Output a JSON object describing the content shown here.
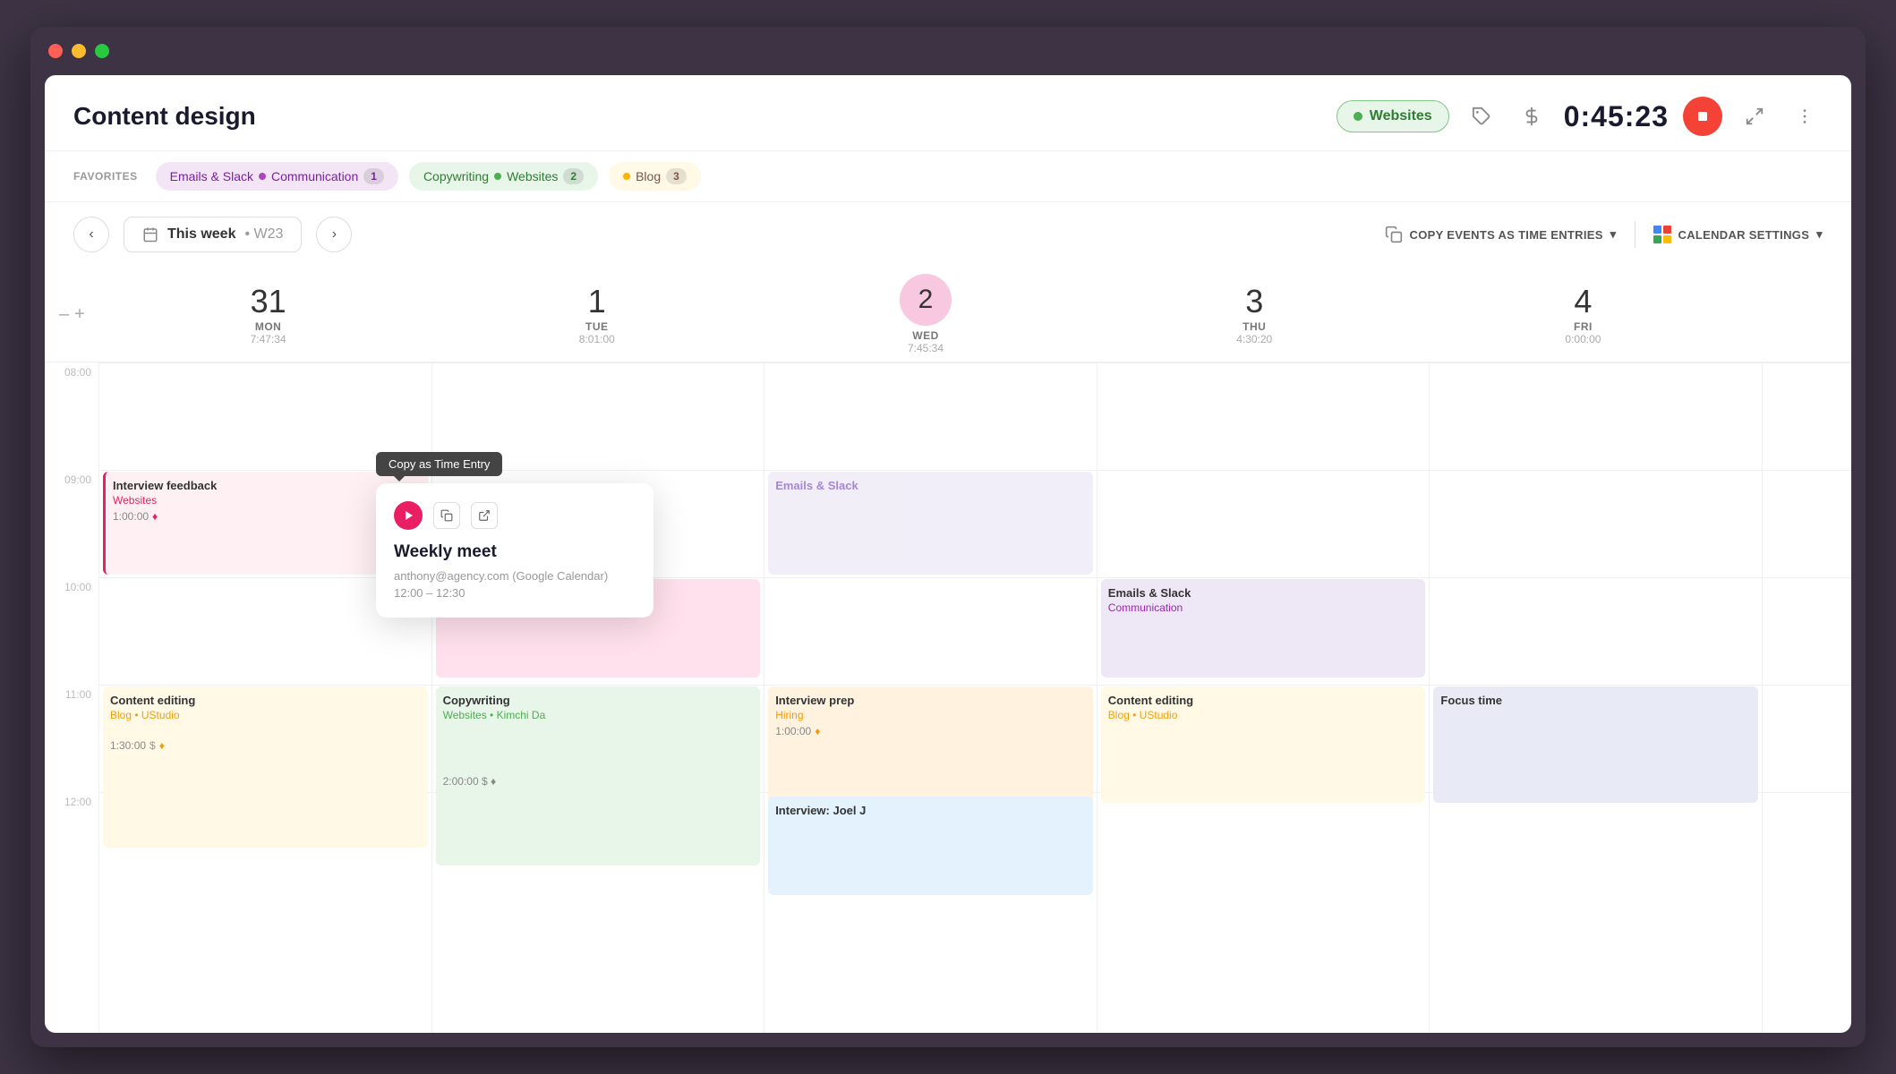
{
  "window": {
    "title": "Content design"
  },
  "header": {
    "title": "Content design",
    "website_badge": "Websites",
    "timer": "0:45:23"
  },
  "favorites": {
    "label": "FAVORITES",
    "items": [
      {
        "name": "emails-slack",
        "text": "Emails & Slack",
        "tag": "Communication",
        "count": "1",
        "color": "purple"
      },
      {
        "name": "copywriting",
        "text": "Copywriting",
        "tag": "Websites",
        "count": "2",
        "color": "green"
      },
      {
        "name": "blog",
        "text": "Blog",
        "count": "3",
        "color": "yellow"
      }
    ]
  },
  "calendar": {
    "week_label": "This week",
    "week_num": "W23",
    "copy_events_label": "COPY EVENTS AS TIME ENTRIES",
    "cal_settings_label": "CALENDAR SETTINGS",
    "days": [
      {
        "num": "31",
        "label": "MON",
        "time": "7:47:34",
        "is_today": false
      },
      {
        "num": "1",
        "label": "TUE",
        "time": "8:01:00",
        "is_today": false
      },
      {
        "num": "2",
        "label": "WED",
        "time": "7:45:34",
        "is_today": true
      },
      {
        "num": "3",
        "label": "THU",
        "time": "4:30:20",
        "is_today": false
      },
      {
        "num": "4",
        "label": "FRI",
        "time": "0:00:00",
        "is_today": false
      }
    ],
    "times": [
      "08:00",
      "09:00",
      "10:00",
      "11:00",
      "12:00"
    ]
  },
  "events": {
    "interview_feedback": {
      "title": "Interview feedback",
      "tag": "Websites",
      "duration": "1:00:00"
    },
    "weekly_meet_mon": {
      "title": "Weekly meet"
    },
    "emails_slack_wed": {
      "title": "Emails & Slack"
    },
    "emails_slack_thu": {
      "title": "Emails & Slack",
      "tag": "Communication"
    },
    "content_editing_mon": {
      "title": "Content editing",
      "tags": "Blog • UStudio",
      "duration": "1:30:00"
    },
    "copywriting_tue": {
      "title": "Copywriting",
      "tags": "Websites • Kimchi Da"
    },
    "interview_prep_wed": {
      "title": "Interview prep",
      "tag": "Hiring",
      "duration": "1:00:00"
    },
    "interview_joel_wed": {
      "title": "Interview: Joel J"
    },
    "content_editing_thu": {
      "title": "Content editing",
      "tags": "Blog • UStudio"
    },
    "focus_time_fri": {
      "title": "Focus time"
    }
  },
  "popup": {
    "tooltip_label": "Copy as Time Entry",
    "title": "Weekly meet",
    "email": "anthony@agency.com (Google Calendar)",
    "time_range": "12:00 – 12:30"
  }
}
